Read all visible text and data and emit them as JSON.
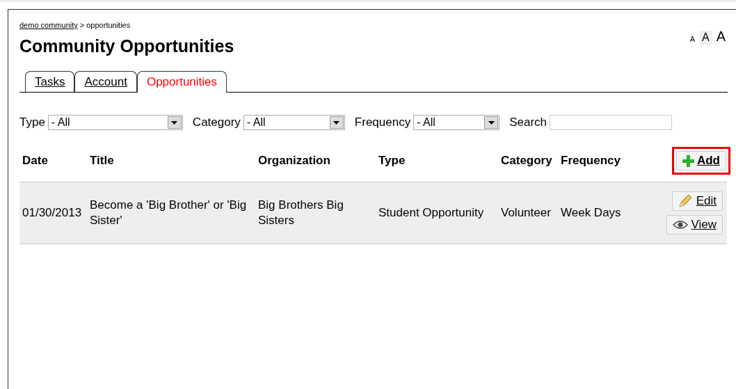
{
  "breadcrumb": {
    "link": "demo community",
    "rest": "> opportunities"
  },
  "text_size": [
    {
      "label": "A",
      "selected": false
    },
    {
      "label": "A",
      "selected": true
    },
    {
      "label": "A",
      "selected": false
    }
  ],
  "title": "Community Opportunities",
  "tabs": [
    {
      "label": "Tasks",
      "selected": false
    },
    {
      "label": "Account",
      "selected": false
    },
    {
      "label": "Opportunities",
      "selected": true
    }
  ],
  "filters": [
    {
      "label": "Type",
      "value": "- All"
    },
    {
      "label": "Category",
      "value": "- All"
    },
    {
      "label": "Frequency",
      "value": "- All"
    }
  ],
  "search": {
    "label": "Search"
  },
  "table": {
    "columns": [
      "Date",
      "Title",
      "Organization",
      "Type",
      "Category",
      "Frequency"
    ],
    "add_button": {
      "label": "Add",
      "highlighted": true
    },
    "rows": [
      {
        "cells": [
          "01/30/2013",
          "Become a 'Big Brother' or 'Big Sister'",
          "Big Brothers Big Sisters",
          "Student Opportunity",
          "Volunteer",
          "Week Days"
        ],
        "actions": [
          {
            "kind": "edit",
            "label": "Edit"
          },
          {
            "kind": "view",
            "label": "View"
          }
        ]
      }
    ]
  }
}
